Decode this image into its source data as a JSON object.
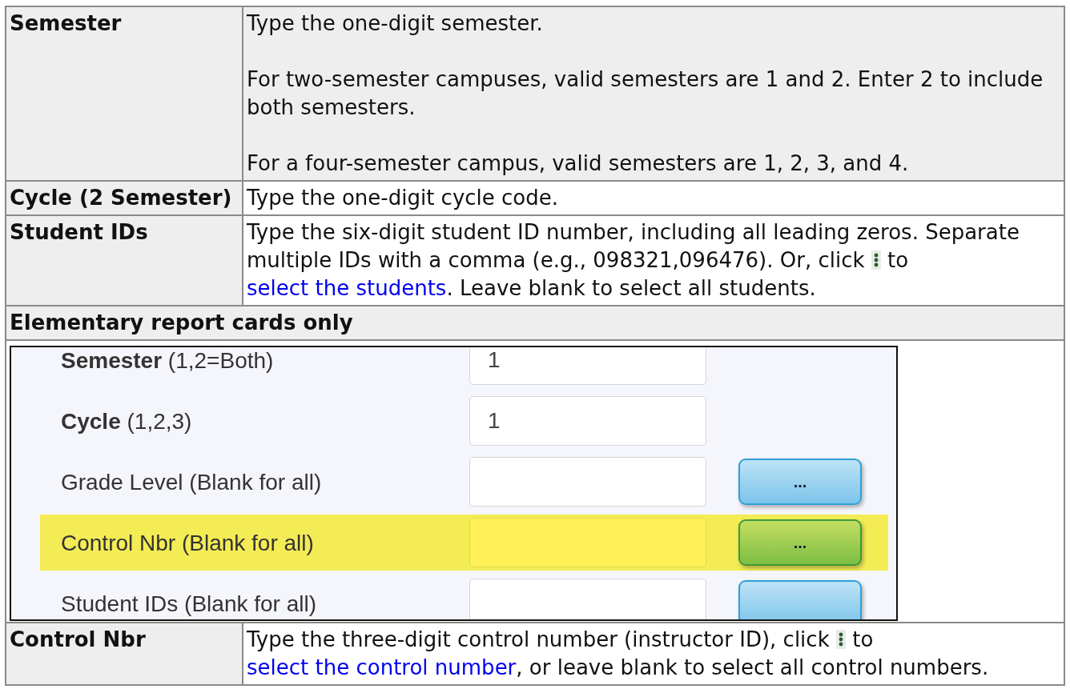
{
  "rows": [
    {
      "kind": "field",
      "term": "Semester",
      "paragraphs": [
        {
          "text": "Type the one-digit semester."
        },
        {
          "text": "For two-semester campuses, valid semesters are 1 and 2. Enter 2 to include both semesters."
        },
        {
          "text": "For a four-semester campus, valid semesters are 1, 2, 3, and 4."
        }
      ]
    },
    {
      "kind": "field",
      "term": "Cycle (2 Semester)",
      "paragraphs": [
        {
          "text": "Type the one-digit cycle code."
        }
      ]
    },
    {
      "kind": "field",
      "term": "Student IDs",
      "paragraphs": [
        {
          "text": "Type the six-digit student ID number, including all leading zeros. Separate multiple IDs with a comma (e.g., 098321,096476). Or, click",
          "after_icon": "to",
          "link": "select the students",
          "after_link": ". Leave blank to select all students."
        }
      ]
    },
    {
      "kind": "heading",
      "term": "Elementary report cards only"
    },
    {
      "kind": "screenshot",
      "fields": [
        {
          "label": "**Semester** (1,2=Both)",
          "value": "1",
          "button": false,
          "highlighted": false
        },
        {
          "label": "**Cycle** (1,2,3)",
          "value": "1",
          "button": false,
          "highlighted": false
        },
        {
          "label": "Grade Level (Blank for all)",
          "button": true,
          "button_label": "...",
          "highlighted": false
        },
        {
          "label": "Control Nbr (Blank for all)",
          "button": true,
          "button_label": "...",
          "highlighted": true
        },
        {
          "label": "Student IDs (Blank for all)",
          "button": true,
          "highlighted": false
        }
      ]
    },
    {
      "kind": "field",
      "term": "Control Nbr",
      "paragraphs": [
        {
          "text": "Type the three-digit control number (instructor ID), click",
          "after_icon": "to",
          "link": "select the control number",
          "after_link": ", or leave blank to select all control numbers."
        }
      ]
    }
  ]
}
